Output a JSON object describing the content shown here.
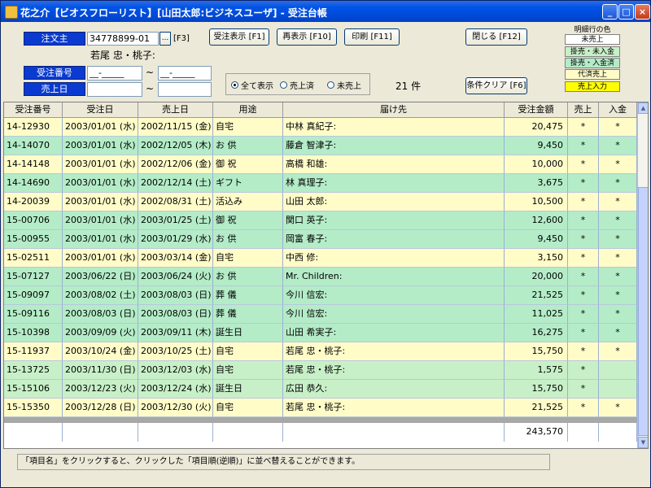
{
  "window": {
    "title": "花之介【ビオスフローリスト】[山田太郎:ビジネスユーザ] - 受注台帳",
    "minimize": "_",
    "maximize": "□",
    "close": "×"
  },
  "form": {
    "customer_label": "注文主",
    "customer_code": "34778899-01",
    "customer_lookup": "...",
    "f3_hint": "[F3]",
    "customer_name": "若尾 忠・桃子:",
    "order_no_label": "受注番号",
    "order_no_from": "__-_____",
    "order_no_to": "__-_____",
    "sales_date_label": "売上日",
    "sales_date_from": "",
    "sales_date_to": "",
    "tilde": "~"
  },
  "buttons": {
    "order_display": "受注表示 [F1]",
    "redisplay": "再表示 [F10]",
    "print": "印刷 [F11]",
    "close": "閉じる [F12]",
    "clear_conditions": "条件クリア [F6]"
  },
  "filter": {
    "options": [
      "全て表示",
      "売上済",
      "未売上"
    ],
    "selected": "全て表示",
    "count_text": "21 件"
  },
  "legend": {
    "title": "明細行の色",
    "items": [
      {
        "label": "未売上",
        "color": "#ffffff"
      },
      {
        "label": "掛売・未入金",
        "color": "#c8f0c8"
      },
      {
        "label": "掛売・入金済",
        "color": "#b4ecc8"
      },
      {
        "label": "代済売上",
        "color": "#fffcc8"
      },
      {
        "label": "売上入力",
        "color": "#ffff00"
      }
    ]
  },
  "table": {
    "columns": [
      "受注番号",
      "受注日",
      "売上日",
      "用途",
      "届け先",
      "受注金額",
      "売上",
      "入金"
    ],
    "rows": [
      {
        "order_no": "14-12930",
        "order_date": "2003/01/01 (水)",
        "sales_date": "2002/11/15 (金)",
        "purpose": "自宅",
        "recipient": "中林 真紀子:",
        "amount": "20,475",
        "sold": "*",
        "paid": "*",
        "color": "#fffcc8"
      },
      {
        "order_no": "14-14070",
        "order_date": "2003/01/01 (水)",
        "sales_date": "2002/12/05 (木)",
        "purpose": "お 供",
        "recipient": "藤倉 智津子:",
        "amount": "9,450",
        "sold": "*",
        "paid": "*",
        "color": "#b4ecc8"
      },
      {
        "order_no": "14-14148",
        "order_date": "2003/01/01 (水)",
        "sales_date": "2002/12/06 (金)",
        "purpose": "御 祝",
        "recipient": "高橋 和雄:",
        "amount": "10,000",
        "sold": "*",
        "paid": "*",
        "color": "#fffcc8"
      },
      {
        "order_no": "14-14690",
        "order_date": "2003/01/01 (水)",
        "sales_date": "2002/12/14 (土)",
        "purpose": "ギフト",
        "recipient": "林 真理子:",
        "amount": "3,675",
        "sold": "*",
        "paid": "*",
        "color": "#b4ecc8"
      },
      {
        "order_no": "14-20039",
        "order_date": "2003/01/01 (水)",
        "sales_date": "2002/08/31 (土)",
        "purpose": "活込み",
        "recipient": "山田 太郎:",
        "amount": "10,500",
        "sold": "*",
        "paid": "*",
        "color": "#fffcc8"
      },
      {
        "order_no": "15-00706",
        "order_date": "2003/01/01 (水)",
        "sales_date": "2003/01/25 (土)",
        "purpose": "御 祝",
        "recipient": "関口 英子:",
        "amount": "12,600",
        "sold": "*",
        "paid": "*",
        "color": "#b4ecc8"
      },
      {
        "order_no": "15-00955",
        "order_date": "2003/01/01 (水)",
        "sales_date": "2003/01/29 (水)",
        "purpose": "お 供",
        "recipient": "岡富 春子:",
        "amount": "9,450",
        "sold": "*",
        "paid": "*",
        "color": "#b4ecc8"
      },
      {
        "order_no": "15-02511",
        "order_date": "2003/01/01 (水)",
        "sales_date": "2003/03/14 (金)",
        "purpose": "自宅",
        "recipient": "中西 修:",
        "amount": "3,150",
        "sold": "*",
        "paid": "*",
        "color": "#fffcc8"
      },
      {
        "order_no": "15-07127",
        "order_date": "2003/06/22 (日)",
        "sales_date": "2003/06/24 (火)",
        "purpose": "お 供",
        "recipient": "Mr. Children:",
        "amount": "20,000",
        "sold": "*",
        "paid": "*",
        "color": "#b4ecc8"
      },
      {
        "order_no": "15-09097",
        "order_date": "2003/08/02 (土)",
        "sales_date": "2003/08/03 (日)",
        "purpose": "葬 儀",
        "recipient": "今川 信宏:",
        "amount": "21,525",
        "sold": "*",
        "paid": "*",
        "color": "#b4ecc8"
      },
      {
        "order_no": "15-09116",
        "order_date": "2003/08/03 (日)",
        "sales_date": "2003/08/03 (日)",
        "purpose": "葬 儀",
        "recipient": "今川 信宏:",
        "amount": "11,025",
        "sold": "*",
        "paid": "*",
        "color": "#b4ecc8"
      },
      {
        "order_no": "15-10398",
        "order_date": "2003/09/09 (火)",
        "sales_date": "2003/09/11 (木)",
        "purpose": "誕生日",
        "recipient": "山田 希実子:",
        "amount": "16,275",
        "sold": "*",
        "paid": "*",
        "color": "#b4ecc8"
      },
      {
        "order_no": "15-11937",
        "order_date": "2003/10/24 (金)",
        "sales_date": "2003/10/25 (土)",
        "purpose": "自宅",
        "recipient": "若尾 忠・桃子:",
        "amount": "15,750",
        "sold": "*",
        "paid": "*",
        "color": "#fffcc8"
      },
      {
        "order_no": "15-13725",
        "order_date": "2003/11/30 (日)",
        "sales_date": "2003/12/03 (水)",
        "purpose": "自宅",
        "recipient": "若尾 忠・桃子:",
        "amount": "1,575",
        "sold": "*",
        "paid": "",
        "color": "#c8f0c8"
      },
      {
        "order_no": "15-15106",
        "order_date": "2003/12/23 (火)",
        "sales_date": "2003/12/24 (水)",
        "purpose": "誕生日",
        "recipient": "広田 恭久:",
        "amount": "15,750",
        "sold": "*",
        "paid": "",
        "color": "#c8f0c8"
      },
      {
        "order_no": "15-15350",
        "order_date": "2003/12/28 (日)",
        "sales_date": "2003/12/30 (火)",
        "purpose": "自宅",
        "recipient": "若尾 忠・桃子:",
        "amount": "21,525",
        "sold": "*",
        "paid": "*",
        "color": "#fffcc8"
      }
    ],
    "total_amount": "243,570"
  },
  "status": {
    "hint": "「項目名」をクリックすると、クリックした「項目順(逆順)」に並べ替えることができます。"
  },
  "scrollbar": {
    "up": "▲",
    "down": "▼"
  }
}
